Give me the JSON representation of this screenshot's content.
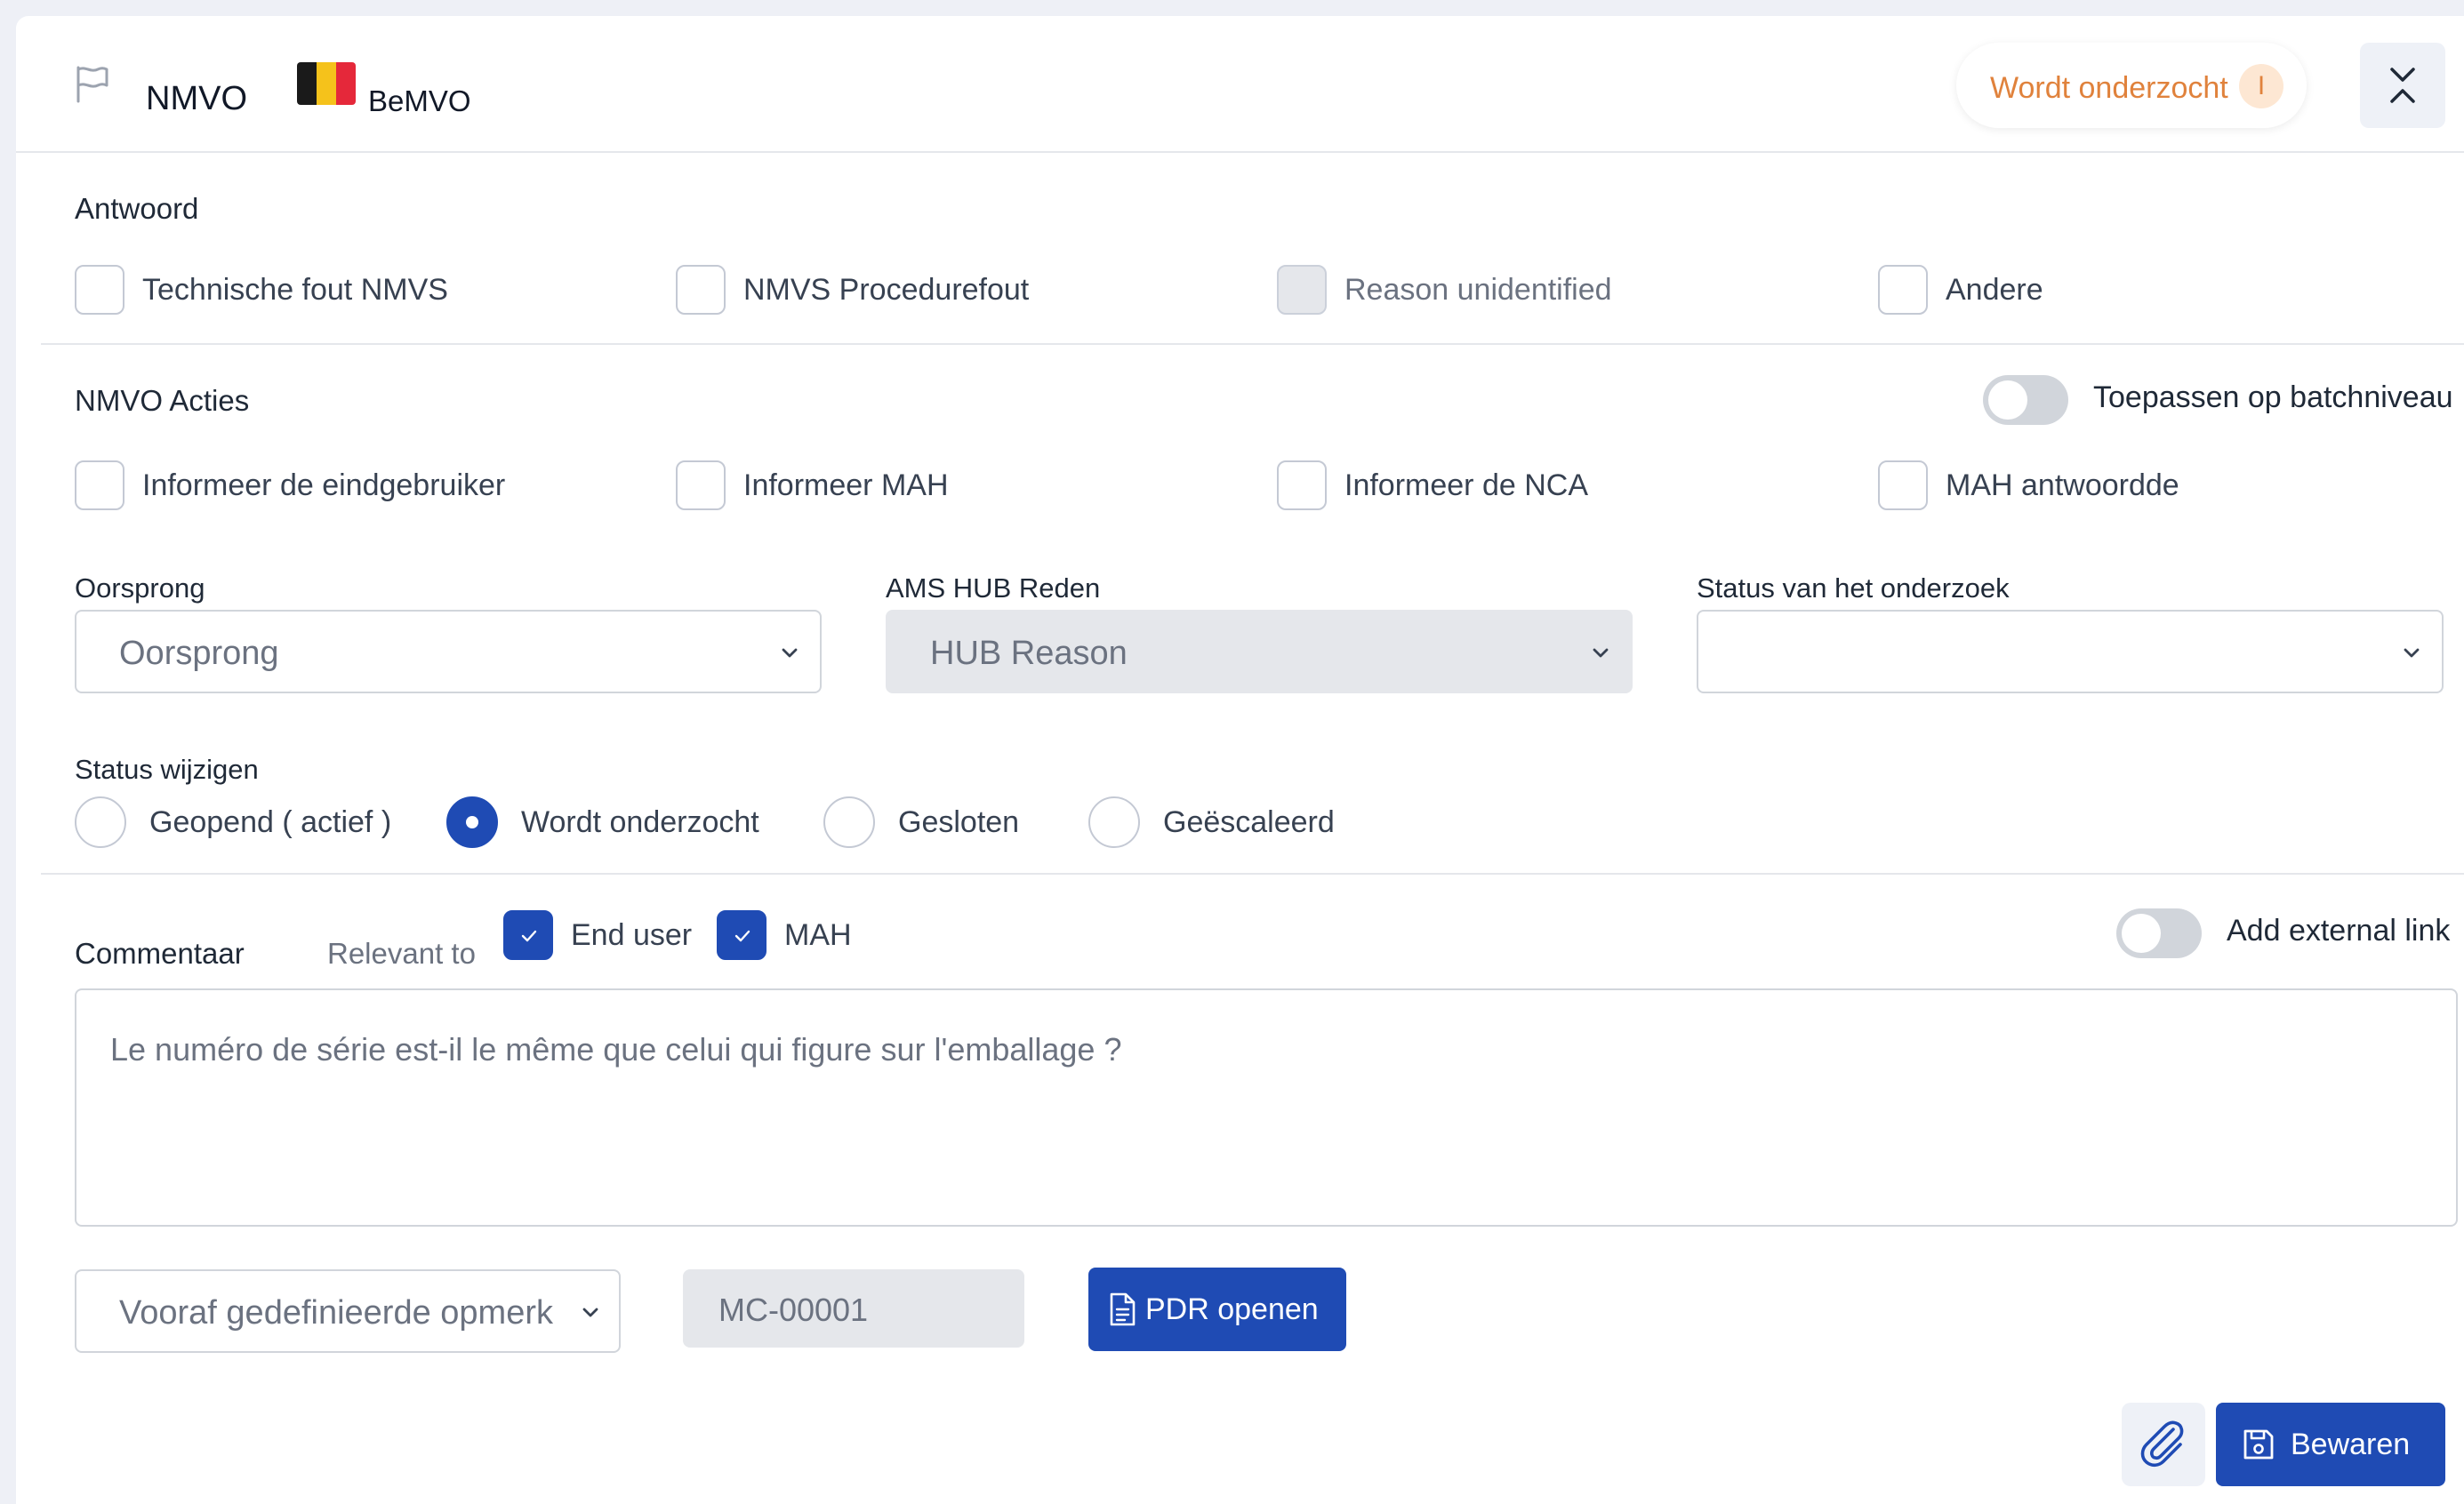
{
  "header": {
    "title": "NMVO",
    "country_code": "BeMVO",
    "status_pill": "Wordt onderzocht",
    "status_badge": "I",
    "colors": {
      "accent": "#1f4bb4",
      "status": "#e0823c"
    },
    "icons": {
      "flag": "flag-outline-icon",
      "collapse": "chevrons-collapse-icon"
    }
  },
  "antwoord": {
    "label": "Antwoord",
    "options": [
      {
        "label": "Technische fout NMVS",
        "checked": false,
        "disabled": false
      },
      {
        "label": "NMVS Procedurefout",
        "checked": false,
        "disabled": false
      },
      {
        "label": "Reason unidentified",
        "checked": false,
        "disabled": true
      },
      {
        "label": "Andere",
        "checked": false,
        "disabled": false
      }
    ]
  },
  "acties": {
    "label": "NMVO Acties",
    "batch_toggle_label": "Toepassen op batchniveau",
    "batch_toggle_on": false,
    "options": [
      {
        "label": "Informeer de eindgebruiker",
        "checked": false
      },
      {
        "label": "Informeer MAH",
        "checked": false
      },
      {
        "label": "Informeer de NCA",
        "checked": false
      },
      {
        "label": "MAH antwoordde",
        "checked": false
      }
    ]
  },
  "fields": {
    "oorsprong": {
      "label": "Oorsprong",
      "placeholder": "Oorsprong"
    },
    "hub_reden": {
      "label": "AMS HUB Reden",
      "placeholder": "HUB Reason",
      "disabled": true
    },
    "status_onderzoek": {
      "label": "Status van het onderzoek",
      "value": ""
    }
  },
  "status_wijzigen": {
    "label": "Status wijzigen",
    "options": [
      {
        "label": "Geopend ( actief )",
        "selected": false
      },
      {
        "label": "Wordt onderzocht",
        "selected": true
      },
      {
        "label": "Gesloten",
        "selected": false
      },
      {
        "label": "Geëscaleerd",
        "selected": false
      }
    ]
  },
  "commentaar": {
    "label": "Commentaar",
    "relevant_to": "Relevant to",
    "end_user": "End user",
    "mah": "MAH",
    "end_user_checked": true,
    "mah_checked": true,
    "external_link_label": "Add external link",
    "external_link_on": false,
    "text": "Le numéro de série est-il le même que celui qui figure sur l'emballage ?"
  },
  "footer": {
    "predefined_placeholder": "Vooraf gedefinieerde opmerk",
    "code": "MC-00001",
    "pdr_button": "PDR openen",
    "save_button": "Bewaren"
  }
}
